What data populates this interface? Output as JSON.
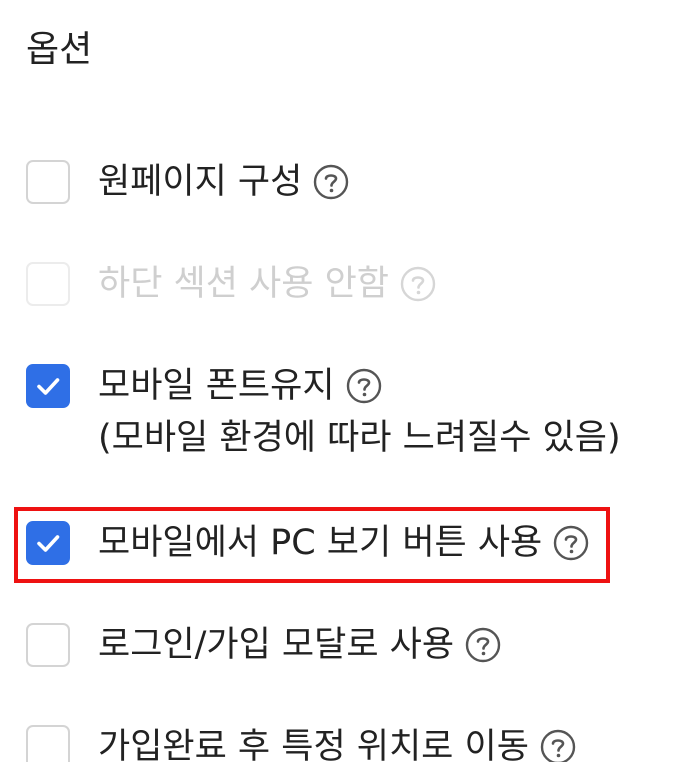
{
  "section": {
    "title": "옵션"
  },
  "options": [
    {
      "label": "원페이지 구성",
      "checked": false,
      "disabled": false
    },
    {
      "label": "하단 섹션 사용 안함",
      "checked": false,
      "disabled": true
    },
    {
      "label": "모바일 폰트유지",
      "sub": "(모바일 환경에 따라 느려질수 있음)",
      "checked": true,
      "disabled": false
    },
    {
      "label": "모바일에서 PC 보기 버튼 사용",
      "checked": true,
      "disabled": false,
      "highlighted": true
    },
    {
      "label": "로그인/가입 모달로 사용",
      "checked": false,
      "disabled": false
    },
    {
      "label": "가입완료 후 특정 위치로 이동",
      "checked": false,
      "disabled": false
    }
  ],
  "colors": {
    "checked": "#2f6fe6",
    "highlight": "#ee1111",
    "disabled_text": "#cfcfcf"
  },
  "icons": {
    "help": "question-circle-icon",
    "check": "checkmark-icon"
  }
}
